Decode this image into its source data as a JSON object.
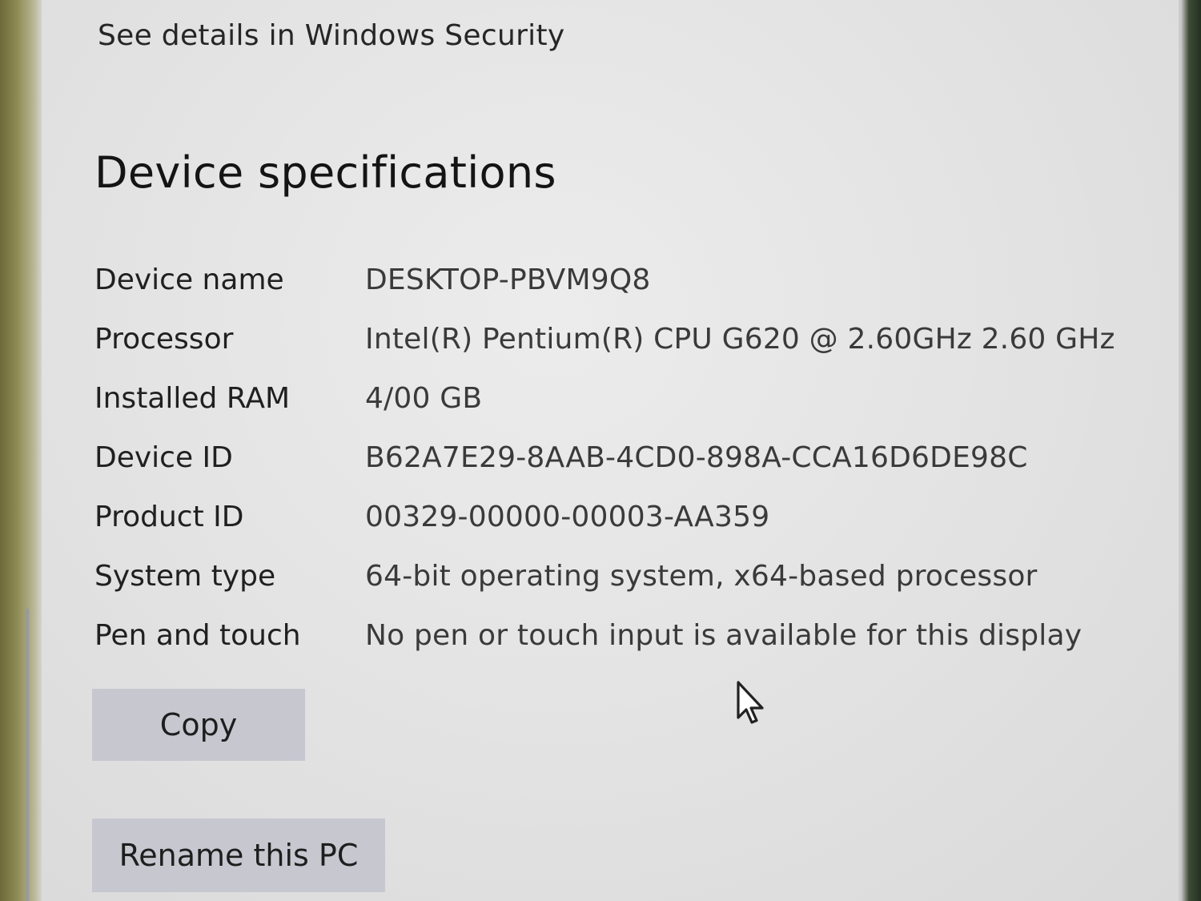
{
  "security": {
    "link_text": "See details in Windows Security"
  },
  "device_specs": {
    "title": "Device specifications",
    "rows": [
      {
        "label": "Device name",
        "value": "DESKTOP-PBVM9Q8"
      },
      {
        "label": "Processor",
        "value": "Intel(R) Pentium(R) CPU G620 @ 2.60GHz   2.60 GHz"
      },
      {
        "label": "Installed RAM",
        "value": "4/00 GB"
      },
      {
        "label": "Device ID",
        "value": "B62A7E29-8AAB-4CD0-898A-CCA16D6DE98C"
      },
      {
        "label": "Product ID",
        "value": "00329-00000-00003-AA359"
      },
      {
        "label": "System type",
        "value": "64-bit operating system, x64-based processor"
      },
      {
        "label": "Pen and touch",
        "value": "No pen or touch input is available for this display"
      }
    ]
  },
  "actions": {
    "copy_label": "Copy",
    "rename_label": "Rename this PC"
  },
  "icons": {
    "pointer": "mouse-pointer-icon"
  }
}
